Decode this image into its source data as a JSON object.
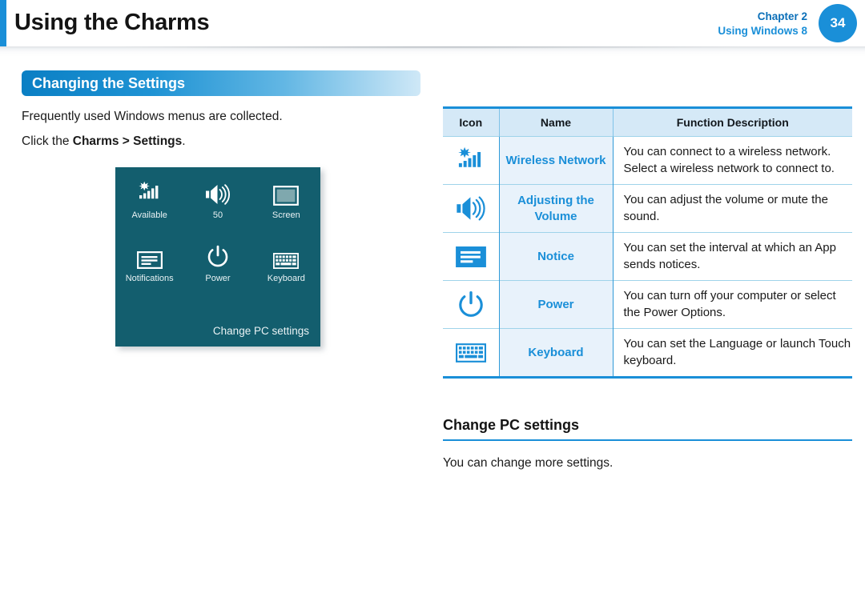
{
  "header": {
    "title": "Using the Charms",
    "chapter_line1": "Chapter 2",
    "chapter_line2": "Using Windows 8",
    "page_number": "34",
    "accent_color": "#1a8fd8"
  },
  "left": {
    "section_title": "Changing the Settings",
    "intro_text": "Frequently used Windows menus are collected.",
    "instruction_prefix": "Click the ",
    "instruction_bold": "Charms > Settings",
    "instruction_suffix": "."
  },
  "charms_panel": {
    "background_color": "#135e6e",
    "items": [
      {
        "icon": "wireless-network-icon",
        "label": "Available"
      },
      {
        "icon": "volume-icon",
        "label": "50"
      },
      {
        "icon": "screen-icon",
        "label": "Screen"
      },
      {
        "icon": "notifications-icon",
        "label": "Notifications"
      },
      {
        "icon": "power-icon",
        "label": "Power"
      },
      {
        "icon": "keyboard-icon",
        "label": "Keyboard"
      }
    ],
    "footer_link": "Change PC settings"
  },
  "table": {
    "headers": [
      "Icon",
      "Name",
      "Function Description"
    ],
    "rows": [
      {
        "icon": "wireless-network-icon",
        "name": "Wireless Network",
        "description": "You can connect to a wireless network. Select a wireless network to connect to."
      },
      {
        "icon": "volume-icon",
        "name": "Adjusting the Volume",
        "description": "You can adjust the volume or mute the sound."
      },
      {
        "icon": "notice-icon",
        "name": "Notice",
        "description": "You can set the interval at which an App sends notices."
      },
      {
        "icon": "power-icon",
        "name": "Power",
        "description": "You can turn off your computer or select the Power Options."
      },
      {
        "icon": "keyboard-icon",
        "name": "Keyboard",
        "description": "You can set the Language or launch Touch keyboard."
      }
    ],
    "name_color": "#1a8fd8",
    "header_bg": "#d5e9f7",
    "border_color": "#1a8fd8"
  },
  "subsection": {
    "heading": "Change PC settings",
    "body": "You can change more settings."
  }
}
